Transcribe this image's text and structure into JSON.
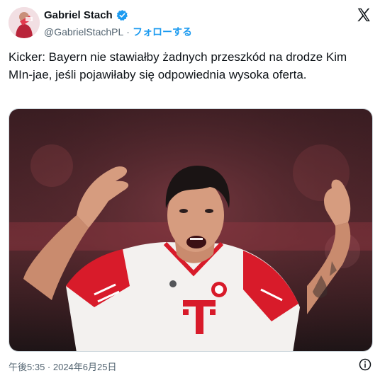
{
  "author": {
    "display_name": "Gabriel Stach",
    "handle": "@GabrielStachPL",
    "separator": "·",
    "follow_label": "フォローする",
    "verified_icon": "verified-badge-icon"
  },
  "tweet": {
    "text": "Kicker: Bayern nie stawiałby żadnych przeszkód na drodze Kim MIn-jae, jeśli pojawiłaby się odpowiednia wysoka oferta.",
    "timestamp": "午後5:35 · 2024年6月25日"
  },
  "icons": {
    "platform_logo": "x-logo-icon",
    "info": "info-icon"
  },
  "colors": {
    "accent": "#1d9bf0",
    "text": "#0f1419",
    "secondary": "#536471",
    "jersey_red": "#d81b2a"
  }
}
